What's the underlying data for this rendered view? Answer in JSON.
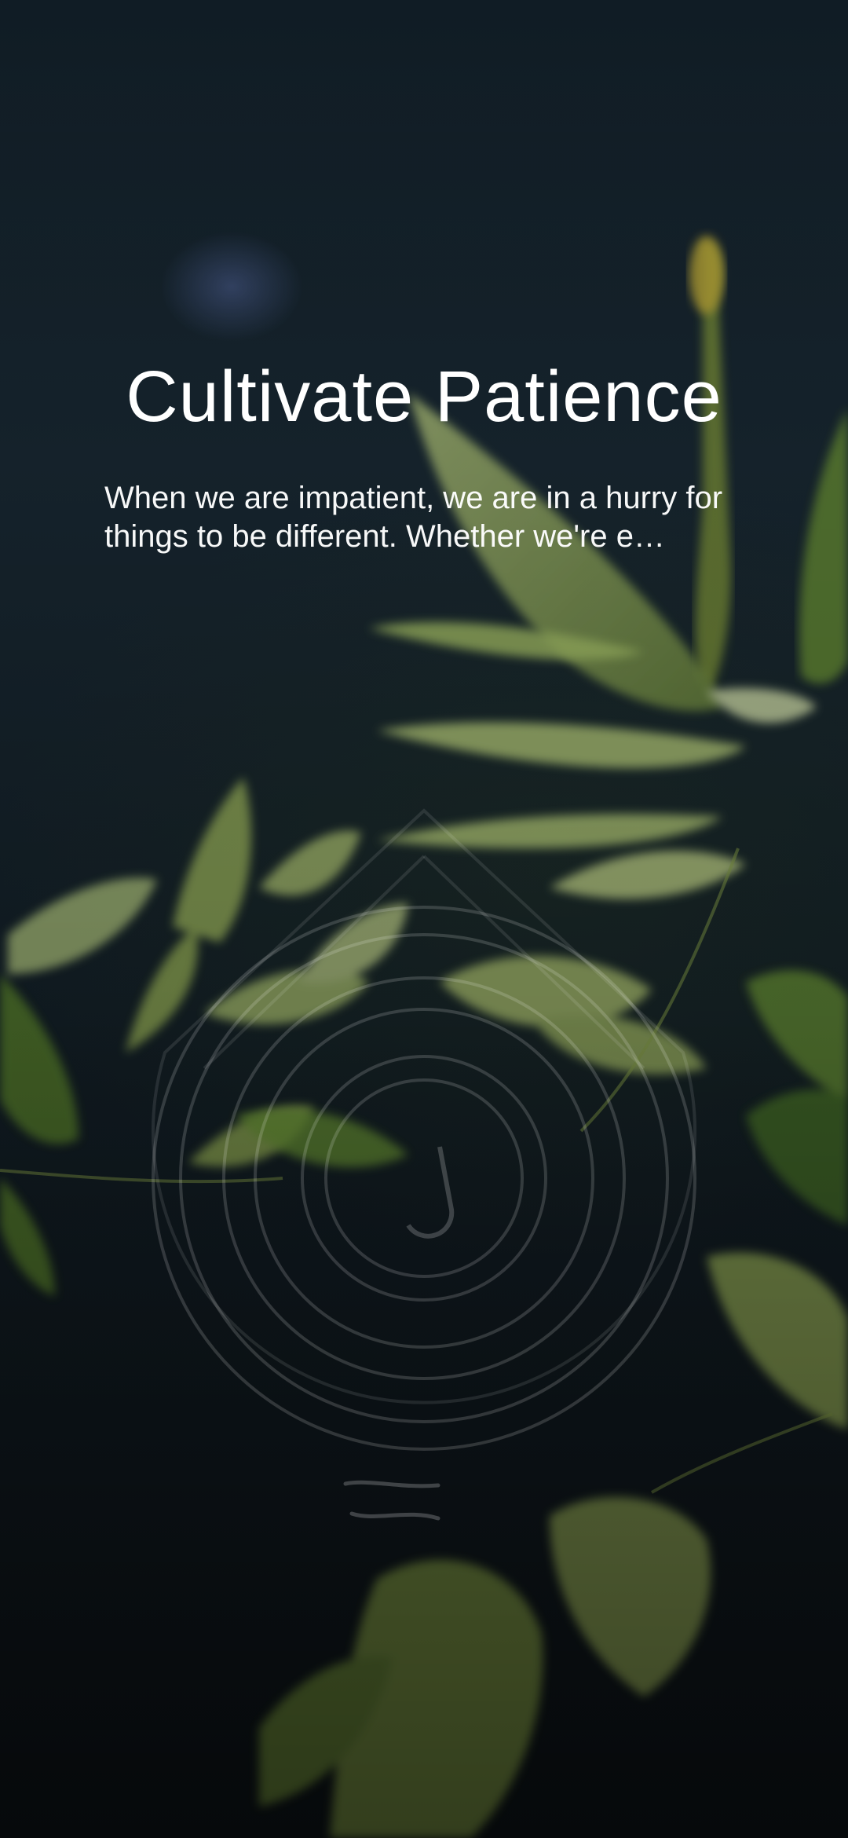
{
  "screen": {
    "title": "Cultivate Patience",
    "description": "When we are impatient, we are in a hurry for things to be different. Whether we're e…"
  },
  "background": {
    "image": "plant-leaves-photo",
    "overlay_color": "#0f1a22",
    "leaf_color": "#b8d27a"
  },
  "icons": {
    "timer": "concentric-rings-timer-icon",
    "handle": "swipe-handle-icon"
  }
}
